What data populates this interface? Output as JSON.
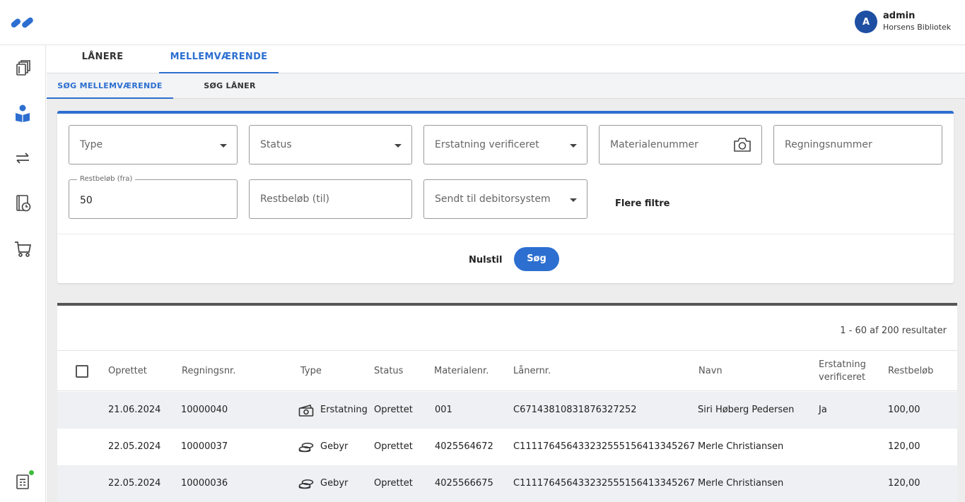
{
  "header": {
    "user": {
      "initial": "A",
      "name": "admin",
      "organization": "Horsens Bibliotek"
    }
  },
  "rail": {
    "items": [
      {
        "icon": "books-icon"
      },
      {
        "icon": "reader-icon"
      },
      {
        "icon": "transfer-arrows-icon"
      },
      {
        "icon": "book-clock-icon"
      },
      {
        "icon": "cart-icon"
      },
      {
        "icon": "report-icon"
      }
    ]
  },
  "tabs": [
    {
      "label": "LÅNERE",
      "active": false
    },
    {
      "label": "MELLEMVÆRENDE",
      "active": true
    }
  ],
  "subtabs": [
    {
      "label": "SØG MELLEMVÆRENDE",
      "active": true
    },
    {
      "label": "SØG LÅNER",
      "active": false
    }
  ],
  "filters": {
    "type": {
      "placeholder": "Type"
    },
    "status": {
      "placeholder": "Status"
    },
    "replacement_verified": {
      "placeholder": "Erstatning verificeret"
    },
    "material_number": {
      "placeholder": "Materialenummer"
    },
    "invoice_number": {
      "placeholder": "Regningsnummer"
    },
    "amount_from": {
      "label": "Restbeløb (fra)",
      "value": "50"
    },
    "amount_to": {
      "placeholder": "Restbeløb (til)"
    },
    "sent_to_debtor": {
      "placeholder": "Sendt til debitorsystem"
    },
    "more_filters": "Flere filtre",
    "reset": "Nulstil",
    "search": "Søg"
  },
  "results": {
    "count_text": "1 - 60 af 200 resultater",
    "columns": [
      "Oprettet",
      "Regningsnr.",
      "Type",
      "Status",
      "Materialenr.",
      "Lånernr.",
      "Navn",
      "Erstatning verificeret",
      "Restbeløb"
    ],
    "rows": [
      {
        "created": "21.06.2024",
        "invoice": "10000040",
        "type_icon": "replacement-icon",
        "type": "Erstatning",
        "status": "Oprettet",
        "material": "001",
        "borrower": "C67143810831876327252",
        "name": "Siri Høberg Pedersen",
        "verified": "Ja",
        "amount": "100,00"
      },
      {
        "created": "22.05.2024",
        "invoice": "10000037",
        "type_icon": "coins-icon",
        "type": "Gebyr",
        "status": "Oprettet",
        "material": "4025564672",
        "borrower": "C11117645643323255515641334526​7",
        "name": "Merle Christiansen",
        "verified": "",
        "amount": "120,00"
      },
      {
        "created": "22.05.2024",
        "invoice": "10000036",
        "type_icon": "coins-icon",
        "type": "Gebyr",
        "status": "Oprettet",
        "material": "4025566675",
        "borrower": "C111176456433232555156413345267",
        "name": "Merle Christiansen",
        "verified": "",
        "amount": "120,00"
      }
    ]
  },
  "colors": {
    "accent": "#2d6fd0",
    "avatar": "#1f4fa3",
    "notification": "#3dbb3d"
  }
}
